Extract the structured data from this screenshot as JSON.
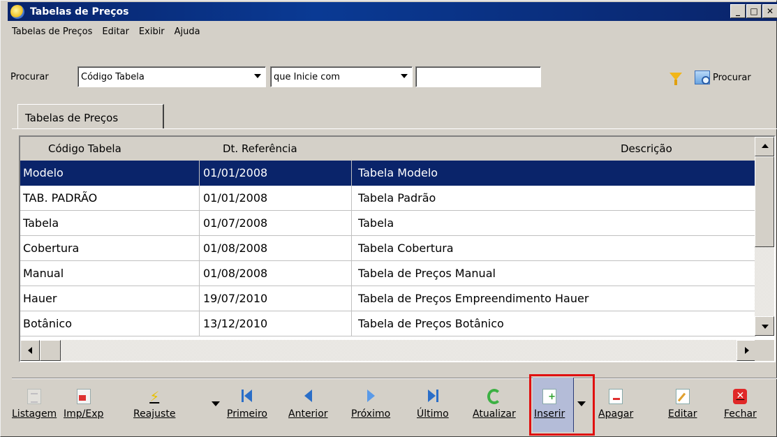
{
  "window": {
    "title": "Tabelas de Preços"
  },
  "menu": [
    "Tabelas de Preços",
    "Editar",
    "Exibir",
    "Ajuda"
  ],
  "search": {
    "label": "Procurar",
    "field_value": "Código Tabela",
    "operator_value": "que Inicie com",
    "text_value": "",
    "button_label": "Procurar"
  },
  "tab": {
    "label": "Tabelas de Preços"
  },
  "grid": {
    "columns": [
      "Código Tabela",
      "Dt. Referência",
      "Descrição"
    ],
    "rows": [
      [
        "Modelo",
        "01/01/2008",
        "Tabela Modelo"
      ],
      [
        "TAB. PADRÃO",
        "01/01/2008",
        "Tabela Padrão"
      ],
      [
        "Tabela",
        "01/07/2008",
        "Tabela"
      ],
      [
        "Cobertura",
        "01/08/2008",
        "Tabela Cobertura"
      ],
      [
        "Manual",
        "01/08/2008",
        "Tabela de Preços Manual"
      ],
      [
        "Hauer",
        "19/07/2010",
        "Tabela de Preços Empreendimento Hauer"
      ],
      [
        "Botânico",
        "13/12/2010",
        "Tabela de Preços Botânico"
      ]
    ],
    "selected_row": 0
  },
  "toolbar": {
    "listagem": "Listagem",
    "impexp": "Imp/Exp",
    "reajuste": "Reajuste",
    "primeiro": "Primeiro",
    "anterior": "Anterior",
    "proximo": "Próximo",
    "ultimo": "Último",
    "atualizar": "Atualizar",
    "inserir": "Inserir",
    "apagar": "Apagar",
    "editar": "Editar",
    "fechar": "Fechar"
  },
  "colors": {
    "titlebar": "#0a246a",
    "selection": "#0a246a",
    "highlight_box": "#e01010"
  }
}
